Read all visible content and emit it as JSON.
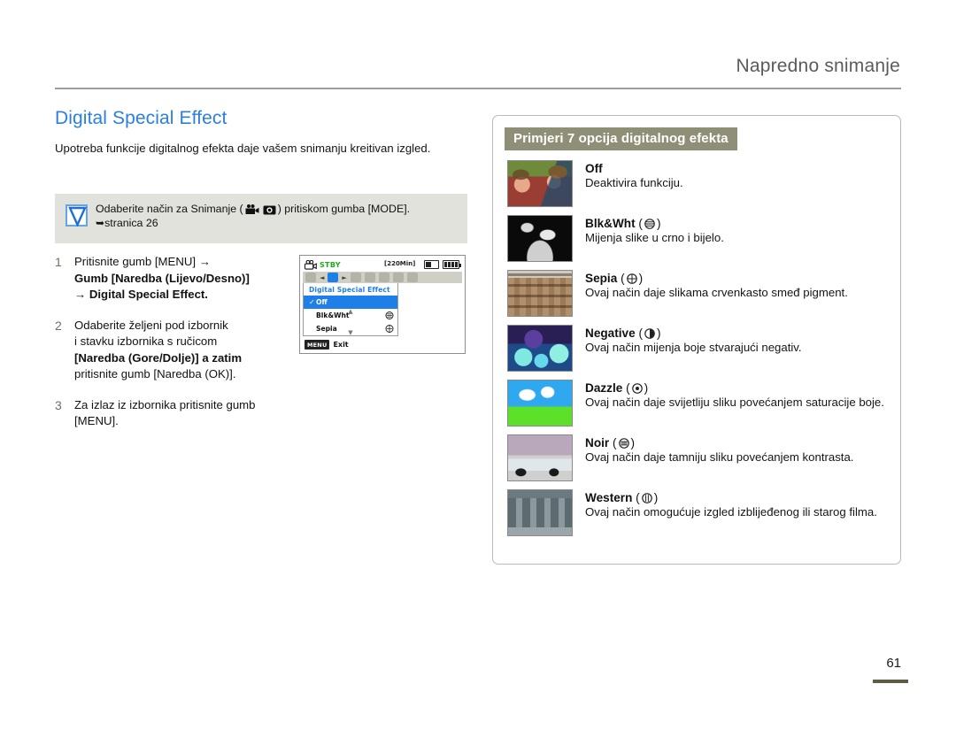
{
  "header": {
    "chapter_title": "Napredno snimanje"
  },
  "left": {
    "section_title": "Digital Special Effect",
    "intro": "Upotreba funkcije digitalnog efekta daje vašem snimanju kreitivan izgled.",
    "tip": {
      "icon": "check-mark-icon",
      "text_before": "Odaberite način za Snimanje (",
      "icons": [
        "video-camera-icon",
        "photo-camera-icon"
      ],
      "text_after": ") pritiskom gumba [MODE].",
      "mode_label": "MODE",
      "page_ref": "stranica 26"
    },
    "steps": [
      {
        "num": "1",
        "lines": [
          "Pritisnite gumb [MENU] →",
          "Gumb [Naredba (Lijevo/Desno)]",
          "→ Digital Special Effect."
        ]
      },
      {
        "num": "2",
        "lines": [
          "Odaberite željeni pod izbornik",
          "i stavku izbornika s ručicom",
          "[Naredba (Gore/Dolje)] a zatim",
          "pritisnite gumb [Naredba (OK)]."
        ]
      },
      {
        "num": "3",
        "lines": [
          "Za izlaz iz izbornika pritisnite gumb [MENU]."
        ]
      }
    ]
  },
  "lcd": {
    "status": "STBY",
    "rec_time": "[220Min]",
    "card_icon": "memory-card-icon",
    "battery_icon": "battery-icon",
    "camera_icon": "camcorder-icon",
    "menu_title": "Digital Special Effect",
    "menu_items": [
      {
        "label": "Off",
        "checked": true,
        "icon": ""
      },
      {
        "label": "Blk&Wht",
        "checked": false,
        "icon": "dial-icon"
      },
      {
        "label": "Sepia",
        "checked": false,
        "icon": "dial-icon"
      }
    ],
    "exit_badge": "MENU",
    "exit_label": "Exit"
  },
  "panel": {
    "header": "Primjeri 7 opcija digitalnog efekta",
    "header_bg": "#8f8f77",
    "effects": [
      {
        "name": "Off",
        "paren": "",
        "desc": "Deaktivira funkciju.",
        "thumb": "th-off",
        "thumb_name": "thumbnail-off"
      },
      {
        "name": "Blk&Wht",
        "paren": "( ◎ )",
        "desc": "Mijenja slike u crno i bijelo.",
        "thumb": "th-bw",
        "thumb_name": "thumbnail-blk-wht"
      },
      {
        "name": "Sepia",
        "paren": "( ◎ )",
        "desc": "Ovaj način daje slikama crvenkasto smeđ pigment.",
        "thumb": "th-sepia",
        "thumb_name": "thumbnail-sepia"
      },
      {
        "name": "Negative",
        "paren": "( ◎ )",
        "desc": "Ovaj način mijenja boje stvarajući negativ.",
        "thumb": "th-neg",
        "thumb_name": "thumbnail-negative"
      },
      {
        "name": "Dazzle",
        "paren": "( ◎ )",
        "desc": "Ovaj način daje svijetliju sliku povećanjem saturacije boje.",
        "thumb": "th-dazzle",
        "thumb_name": "thumbnail-dazzle"
      },
      {
        "name": "Noir",
        "paren": "( ◎ )",
        "desc": "Ovaj način daje tamniju sliku povećanjem kontrasta.",
        "thumb": "th-noir",
        "thumb_name": "thumbnail-noir"
      },
      {
        "name": "Western",
        "paren": "( ◎ )",
        "desc": "Ovaj način omogućuje izgled izblijeđenog ili starog filma.",
        "thumb": "th-west",
        "thumb_name": "thumbnail-western"
      }
    ]
  },
  "footer": {
    "page_number": "61"
  },
  "colors": {
    "accent_blue": "#2b7fe0",
    "panel_header": "#8f8f77",
    "tip_bg": "#e2e2dc",
    "lcd_highlight": "#1f7fe8",
    "footer_rule": "#5d5d42"
  }
}
